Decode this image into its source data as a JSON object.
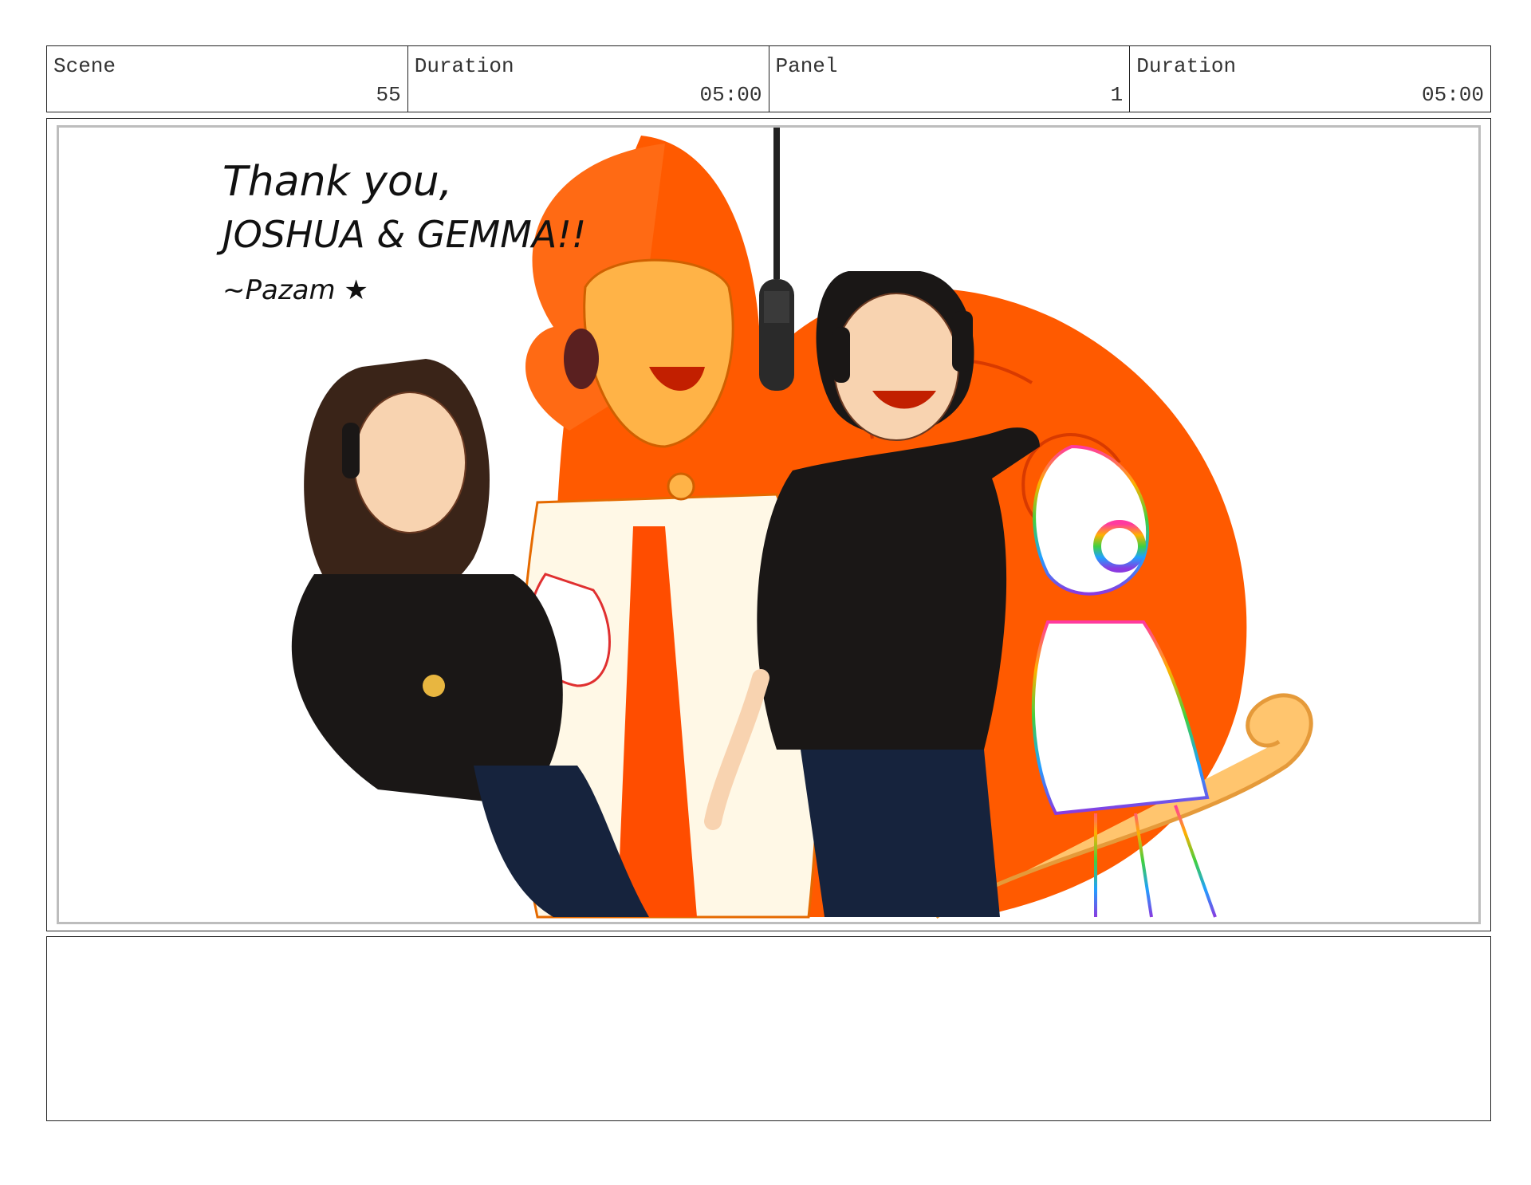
{
  "header": {
    "scene_label": "Scene",
    "scene_value": "55",
    "scene_duration_label": "Duration",
    "scene_duration_value": "05:00",
    "panel_label": "Panel",
    "panel_value": "1",
    "panel_duration_label": "Duration",
    "panel_duration_value": "05:00"
  },
  "artwork": {
    "line1": "Thank you,",
    "line2": "JOSHUA & GEMMA!!",
    "signature": "~Pazam ★"
  },
  "colors": {
    "hair_orange": "#ff5a00",
    "skin_gold": "#ffb347",
    "shirt_black": "#1a1716",
    "jeans_navy": "#16233d",
    "cream": "#fff8e6"
  },
  "notes": {
    "text": ""
  }
}
